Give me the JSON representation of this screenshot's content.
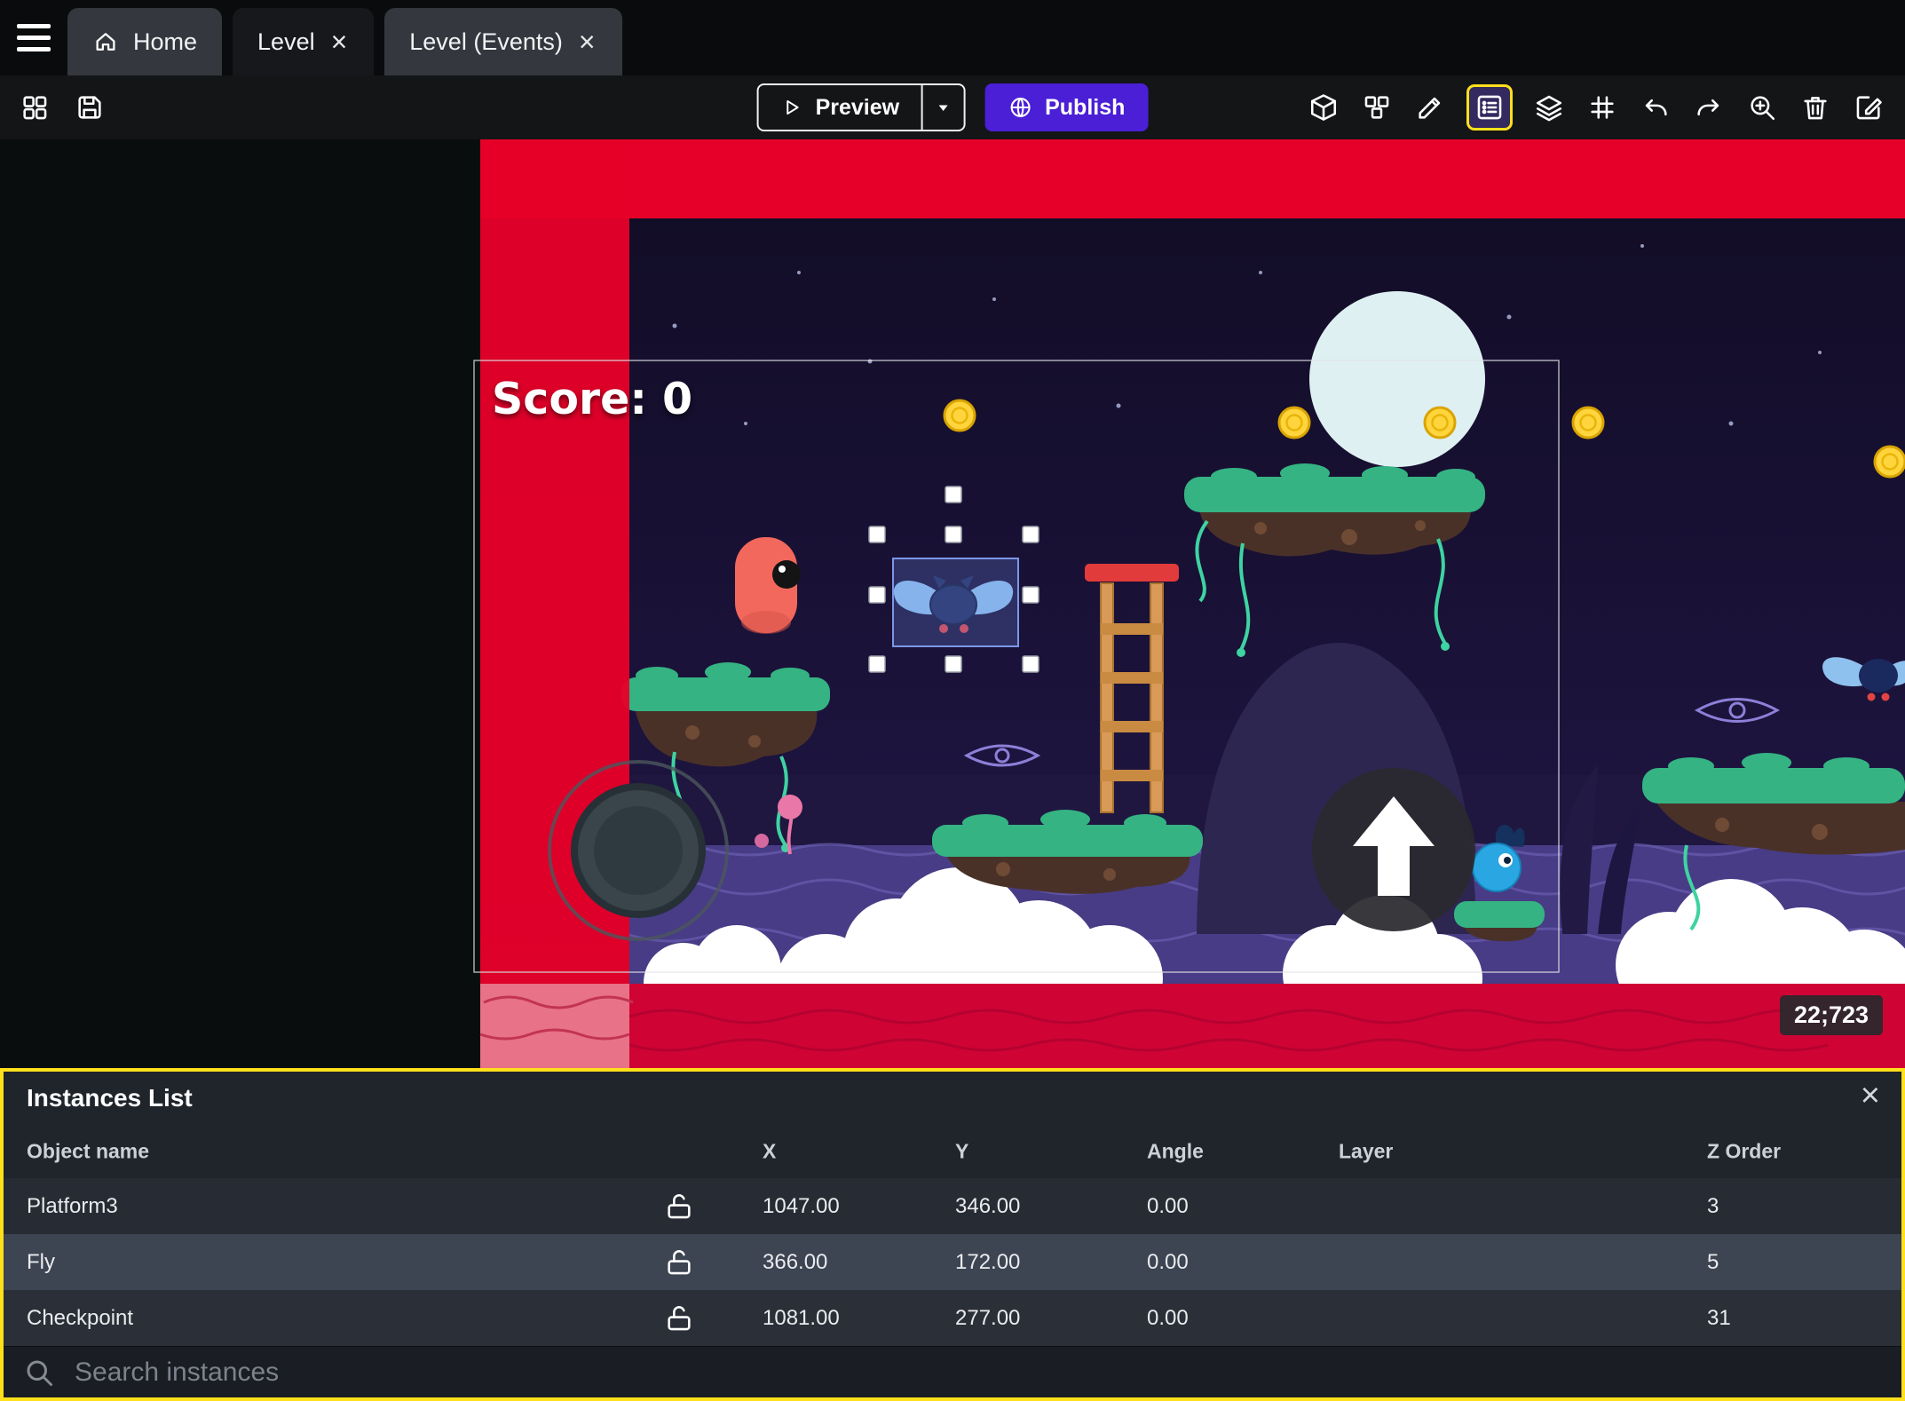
{
  "icons": {
    "close_glyph": "×"
  },
  "tabbar": {
    "tabs": [
      {
        "label": "Home"
      },
      {
        "label": "Level"
      },
      {
        "label": "Level (Events)"
      }
    ]
  },
  "toolbar": {
    "preview_label": "Preview",
    "publish_label": "Publish"
  },
  "scene": {
    "score_label": "Score: 0",
    "coordinates_badge": "22;723"
  },
  "instances_panel": {
    "title": "Instances List",
    "columns": [
      "Object name",
      "X",
      "Y",
      "Angle",
      "Layer",
      "Z Order"
    ],
    "rows": [
      {
        "name": "Platform3",
        "x": "1047.00",
        "y": "346.00",
        "angle": "0.00",
        "layer": "",
        "z_order": "3"
      },
      {
        "name": "Fly",
        "x": "366.00",
        "y": "172.00",
        "angle": "0.00",
        "layer": "",
        "z_order": "5"
      },
      {
        "name": "Checkpoint",
        "x": "1081.00",
        "y": "277.00",
        "angle": "0.00",
        "layer": "",
        "z_order": "31"
      }
    ],
    "search_placeholder": "Search instances"
  },
  "colors": {
    "highlight_yellow": "#ffe01a",
    "publish_purple": "#4a1fd6",
    "overlay_red": "#e60029",
    "platform_green": "#35b383",
    "selection_blue": "#7b97e8"
  }
}
